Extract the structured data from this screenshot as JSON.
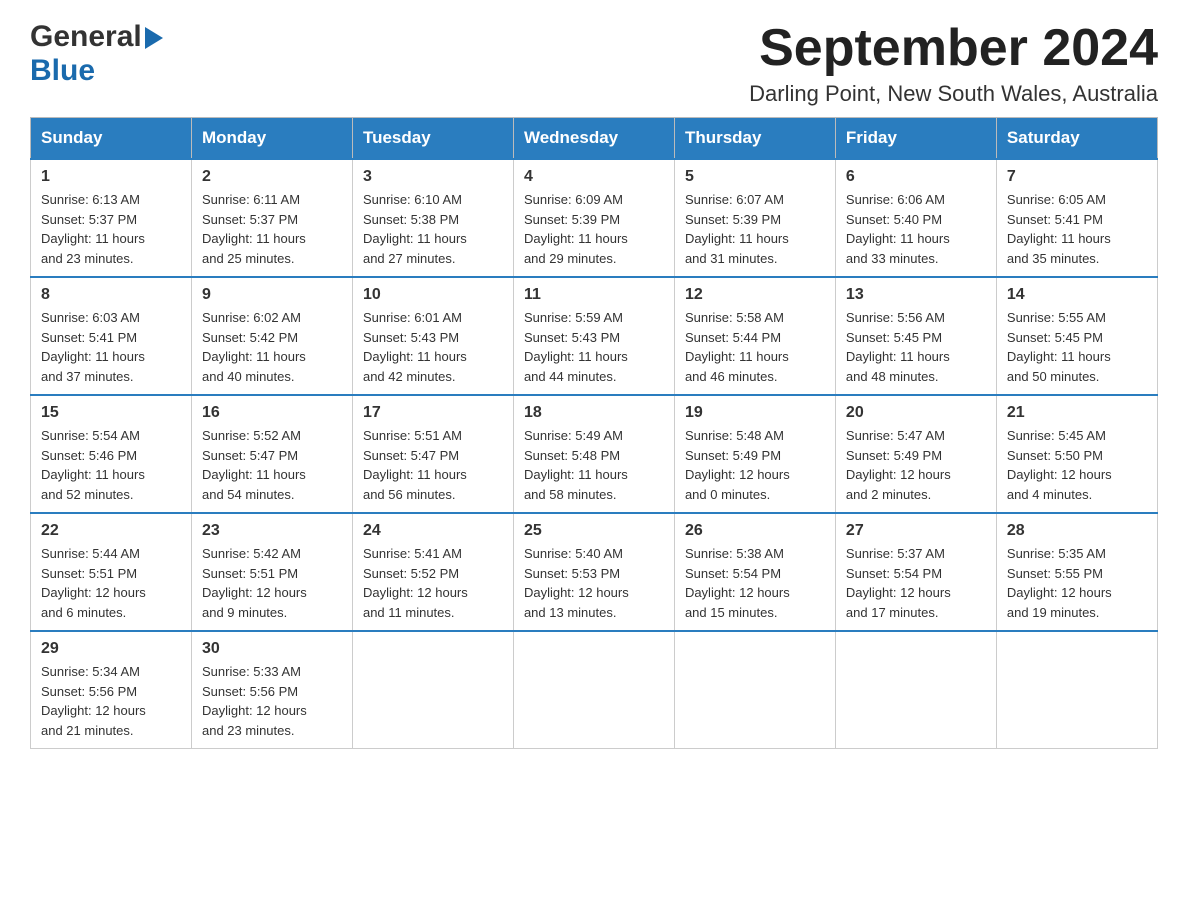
{
  "logo": {
    "general": "General",
    "blue": "Blue"
  },
  "title": {
    "month_year": "September 2024",
    "location": "Darling Point, New South Wales, Australia"
  },
  "days_header": [
    "Sunday",
    "Monday",
    "Tuesday",
    "Wednesday",
    "Thursday",
    "Friday",
    "Saturday"
  ],
  "weeks": [
    [
      {
        "day": "1",
        "sunrise": "6:13 AM",
        "sunset": "5:37 PM",
        "daylight": "11 hours and 23 minutes."
      },
      {
        "day": "2",
        "sunrise": "6:11 AM",
        "sunset": "5:37 PM",
        "daylight": "11 hours and 25 minutes."
      },
      {
        "day": "3",
        "sunrise": "6:10 AM",
        "sunset": "5:38 PM",
        "daylight": "11 hours and 27 minutes."
      },
      {
        "day": "4",
        "sunrise": "6:09 AM",
        "sunset": "5:39 PM",
        "daylight": "11 hours and 29 minutes."
      },
      {
        "day": "5",
        "sunrise": "6:07 AM",
        "sunset": "5:39 PM",
        "daylight": "11 hours and 31 minutes."
      },
      {
        "day": "6",
        "sunrise": "6:06 AM",
        "sunset": "5:40 PM",
        "daylight": "11 hours and 33 minutes."
      },
      {
        "day": "7",
        "sunrise": "6:05 AM",
        "sunset": "5:41 PM",
        "daylight": "11 hours and 35 minutes."
      }
    ],
    [
      {
        "day": "8",
        "sunrise": "6:03 AM",
        "sunset": "5:41 PM",
        "daylight": "11 hours and 37 minutes."
      },
      {
        "day": "9",
        "sunrise": "6:02 AM",
        "sunset": "5:42 PM",
        "daylight": "11 hours and 40 minutes."
      },
      {
        "day": "10",
        "sunrise": "6:01 AM",
        "sunset": "5:43 PM",
        "daylight": "11 hours and 42 minutes."
      },
      {
        "day": "11",
        "sunrise": "5:59 AM",
        "sunset": "5:43 PM",
        "daylight": "11 hours and 44 minutes."
      },
      {
        "day": "12",
        "sunrise": "5:58 AM",
        "sunset": "5:44 PM",
        "daylight": "11 hours and 46 minutes."
      },
      {
        "day": "13",
        "sunrise": "5:56 AM",
        "sunset": "5:45 PM",
        "daylight": "11 hours and 48 minutes."
      },
      {
        "day": "14",
        "sunrise": "5:55 AM",
        "sunset": "5:45 PM",
        "daylight": "11 hours and 50 minutes."
      }
    ],
    [
      {
        "day": "15",
        "sunrise": "5:54 AM",
        "sunset": "5:46 PM",
        "daylight": "11 hours and 52 minutes."
      },
      {
        "day": "16",
        "sunrise": "5:52 AM",
        "sunset": "5:47 PM",
        "daylight": "11 hours and 54 minutes."
      },
      {
        "day": "17",
        "sunrise": "5:51 AM",
        "sunset": "5:47 PM",
        "daylight": "11 hours and 56 minutes."
      },
      {
        "day": "18",
        "sunrise": "5:49 AM",
        "sunset": "5:48 PM",
        "daylight": "11 hours and 58 minutes."
      },
      {
        "day": "19",
        "sunrise": "5:48 AM",
        "sunset": "5:49 PM",
        "daylight": "12 hours and 0 minutes."
      },
      {
        "day": "20",
        "sunrise": "5:47 AM",
        "sunset": "5:49 PM",
        "daylight": "12 hours and 2 minutes."
      },
      {
        "day": "21",
        "sunrise": "5:45 AM",
        "sunset": "5:50 PM",
        "daylight": "12 hours and 4 minutes."
      }
    ],
    [
      {
        "day": "22",
        "sunrise": "5:44 AM",
        "sunset": "5:51 PM",
        "daylight": "12 hours and 6 minutes."
      },
      {
        "day": "23",
        "sunrise": "5:42 AM",
        "sunset": "5:51 PM",
        "daylight": "12 hours and 9 minutes."
      },
      {
        "day": "24",
        "sunrise": "5:41 AM",
        "sunset": "5:52 PM",
        "daylight": "12 hours and 11 minutes."
      },
      {
        "day": "25",
        "sunrise": "5:40 AM",
        "sunset": "5:53 PM",
        "daylight": "12 hours and 13 minutes."
      },
      {
        "day": "26",
        "sunrise": "5:38 AM",
        "sunset": "5:54 PM",
        "daylight": "12 hours and 15 minutes."
      },
      {
        "day": "27",
        "sunrise": "5:37 AM",
        "sunset": "5:54 PM",
        "daylight": "12 hours and 17 minutes."
      },
      {
        "day": "28",
        "sunrise": "5:35 AM",
        "sunset": "5:55 PM",
        "daylight": "12 hours and 19 minutes."
      }
    ],
    [
      {
        "day": "29",
        "sunrise": "5:34 AM",
        "sunset": "5:56 PM",
        "daylight": "12 hours and 21 minutes."
      },
      {
        "day": "30",
        "sunrise": "5:33 AM",
        "sunset": "5:56 PM",
        "daylight": "12 hours and 23 minutes."
      },
      null,
      null,
      null,
      null,
      null
    ]
  ],
  "labels": {
    "sunrise": "Sunrise:",
    "sunset": "Sunset:",
    "daylight": "Daylight:"
  }
}
